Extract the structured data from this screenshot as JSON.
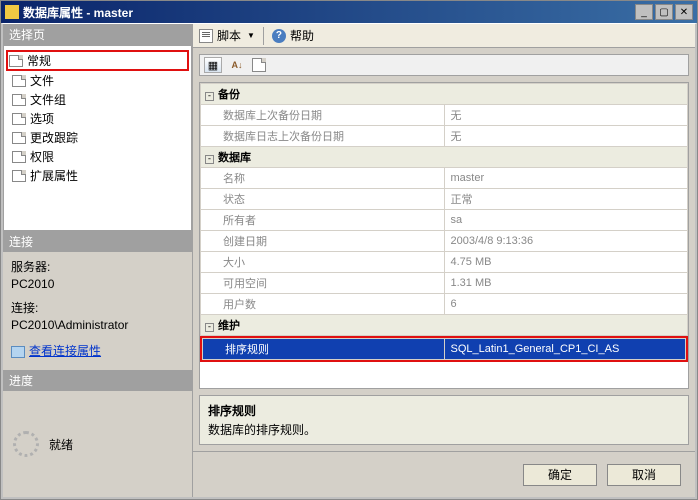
{
  "window": {
    "title": "数据库属性 - master"
  },
  "toolbar": {
    "script": "脚本",
    "help": "帮助"
  },
  "left": {
    "select_pages": "选择页",
    "pages": [
      "常规",
      "文件",
      "文件组",
      "选项",
      "更改跟踪",
      "权限",
      "扩展属性"
    ],
    "connection_header": "连接",
    "server_label": "服务器:",
    "server_value": "PC2010",
    "conn_label": "连接:",
    "conn_value": "PC2010\\Administrator",
    "view_conn_link": "查看连接属性",
    "progress_header": "进度",
    "progress_status": "就绪"
  },
  "props": {
    "cat_backup": "备份",
    "last_db_backup": {
      "label": "数据库上次备份日期",
      "value": "无"
    },
    "last_log_backup": {
      "label": "数据库日志上次备份日期",
      "value": "无"
    },
    "cat_database": "数据库",
    "name": {
      "label": "名称",
      "value": "master"
    },
    "status": {
      "label": "状态",
      "value": "正常"
    },
    "owner": {
      "label": "所有者",
      "value": "sa"
    },
    "created": {
      "label": "创建日期",
      "value": "2003/4/8 9:13:36"
    },
    "size": {
      "label": "大小",
      "value": "4.75 MB"
    },
    "available": {
      "label": "可用空间",
      "value": "1.31 MB"
    },
    "users": {
      "label": "用户数",
      "value": "6"
    },
    "cat_maint": "维护",
    "collation": {
      "label": "排序规则",
      "value": "SQL_Latin1_General_CP1_CI_AS"
    }
  },
  "desc": {
    "title": "排序规则",
    "text": "数据库的排序规则。"
  },
  "buttons": {
    "ok": "确定",
    "cancel": "取消"
  }
}
